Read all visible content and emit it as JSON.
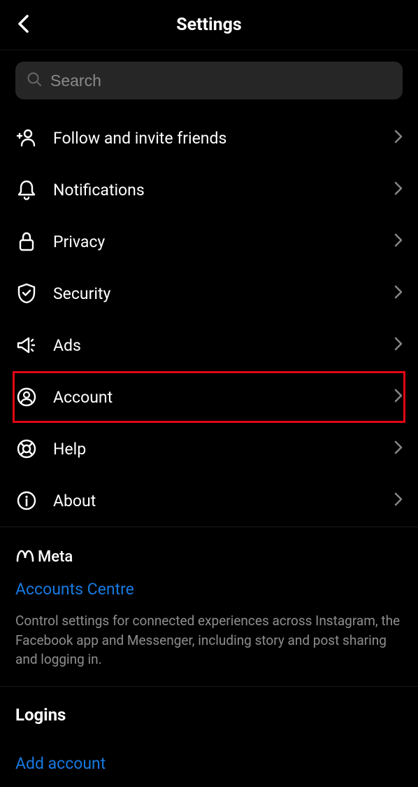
{
  "header": {
    "title": "Settings"
  },
  "search": {
    "placeholder": "Search"
  },
  "menu": {
    "follow": "Follow and invite friends",
    "notifications": "Notifications",
    "privacy": "Privacy",
    "security": "Security",
    "ads": "Ads",
    "account": "Account",
    "help": "Help",
    "about": "About"
  },
  "meta": {
    "brand": "Meta",
    "accounts_centre": "Accounts Centre",
    "desc": "Control settings for connected experiences across Instagram, the Facebook app and Messenger, including story and post sharing and logging in."
  },
  "logins": {
    "title": "Logins",
    "add_account": "Add account"
  }
}
